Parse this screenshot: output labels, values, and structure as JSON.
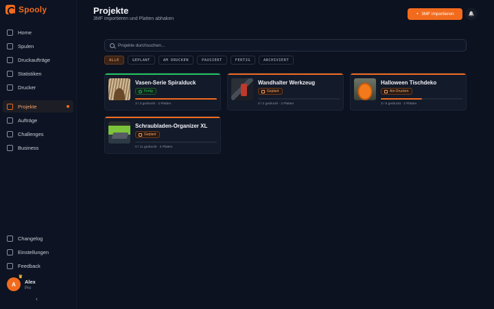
{
  "app": {
    "logo_text": "Spooly"
  },
  "sidebar": {
    "main_items": [
      {
        "label": "Home",
        "icon": "home-icon"
      },
      {
        "label": "Spulen",
        "icon": "cube-icon"
      },
      {
        "label": "Druckaufträge",
        "icon": "printer-icon"
      },
      {
        "label": "Statistiken",
        "icon": "chart-icon"
      },
      {
        "label": "Drucker",
        "icon": "layers-icon"
      },
      {
        "label": "Projekte",
        "icon": "folder-icon",
        "active": true
      },
      {
        "label": "Aufträge",
        "icon": "document-icon"
      },
      {
        "label": "Challenges",
        "icon": "trophy-icon"
      },
      {
        "label": "Business",
        "icon": "building-icon"
      }
    ],
    "bottom_items": [
      {
        "label": "Changelog",
        "icon": "document-icon"
      },
      {
        "label": "Einstellungen",
        "icon": "gear-icon"
      },
      {
        "label": "Feedback",
        "icon": "chat-icon"
      }
    ],
    "user": {
      "initial": "A",
      "name": "Alex",
      "plan": "Pro"
    },
    "collapse_glyph": "‹"
  },
  "header": {
    "title": "Projekte",
    "subtitle": "3MF importieren und Platten abhaken",
    "import_button": "3MF importieren",
    "import_glyph": "+",
    "bell_glyph": "🔔"
  },
  "search": {
    "placeholder": "Projekte durchsuchen..."
  },
  "filters": [
    "ALLE",
    "GEPLANT",
    "AM DRUCKEN",
    "PAUSIERT",
    "FERTIG",
    "ARCHIVIERT"
  ],
  "active_filter": "ALLE",
  "colors": {
    "accent": "#f26b1d",
    "done": "#22c55e",
    "background": "#0c1220"
  },
  "projects": [
    {
      "title": "Vasen-Serie Spiralduck",
      "status": "Fertig",
      "progress": 1.0,
      "meta": "3 / 3 gedruckt · 2 Platten",
      "accent": "#22c55e",
      "thumb": "vase-thumbnail"
    },
    {
      "title": "Wandhalter Werkzeug",
      "status": "Geplant",
      "progress": 0.0,
      "meta": "0 / 2 gedruckt · 2 Platten",
      "accent": "#f26b1d",
      "thumb": "tool-holder-thumbnail"
    },
    {
      "title": "Halloween Tischdeko",
      "status": "Am Drucken",
      "progress": 0.5,
      "meta": "3 / 6 gedruckt · 2 Platten",
      "accent": "#f26b1d",
      "thumb": "pumpkin-thumbnail"
    },
    {
      "title": "Schraubladen-Organizer XL",
      "status": "Geplant",
      "progress": 0.0,
      "meta": "0 / 11 gedruckt · 3 Platten",
      "accent": "#f26b1d",
      "thumb": "organizer-thumbnail"
    }
  ]
}
